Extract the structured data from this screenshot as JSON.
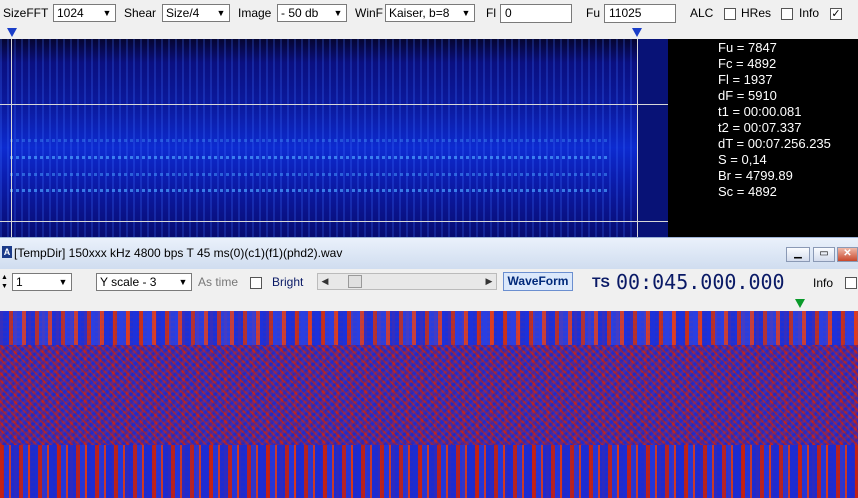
{
  "toolbar_top": {
    "sizefft_label": "SizeFFT",
    "sizefft_value": "1024",
    "shear_label": "Shear",
    "shear_value": "Size/4",
    "image_label": "Image",
    "image_value": "- 50 db",
    "winf_label": "WinF",
    "winf_value": "Kaiser, b=8",
    "fl_label": "Fl",
    "fl_value": "0",
    "fu_label": "Fu",
    "fu_value": "11025",
    "alc_label": "ALC",
    "alc_checked": false,
    "hres_label": "HRes",
    "hres_checked": false,
    "info_label": "Info",
    "info_checked": true
  },
  "spectrum_info": {
    "fu": "Fu = 7847",
    "fc": "Fc = 4892",
    "fl": "Fl = 1937",
    "df": "dF = 5910",
    "t1": "t1 = 00:00.081",
    "t2": "t2 = 00:07.337",
    "dt": "dT = 00:07.256.235",
    "s": "S = 0,14",
    "br": "Br = 4799.89",
    "sc": "Sc = 4892"
  },
  "window": {
    "icon_letter": "A",
    "title": "[TempDir] 150xxx kHz 4800 bps T 45 ms(0)(c1)(f1)(phd2).wav"
  },
  "toolbar_bottom": {
    "spin_value": "1",
    "yscale_value": "Y scale - 3",
    "as_time_label": "As time",
    "bright_label": "Bright",
    "waveform_label": "WaveForm",
    "ts_label": "TS",
    "ts_value": "00:045.000.000",
    "info_label": "Info"
  },
  "colors": {
    "spectrum_bg": "#0a1490",
    "info_bg": "#000000",
    "marker_blue": "#1a3ec8",
    "marker_green": "#0a9a2a",
    "ts_color": "#0a1a66"
  }
}
